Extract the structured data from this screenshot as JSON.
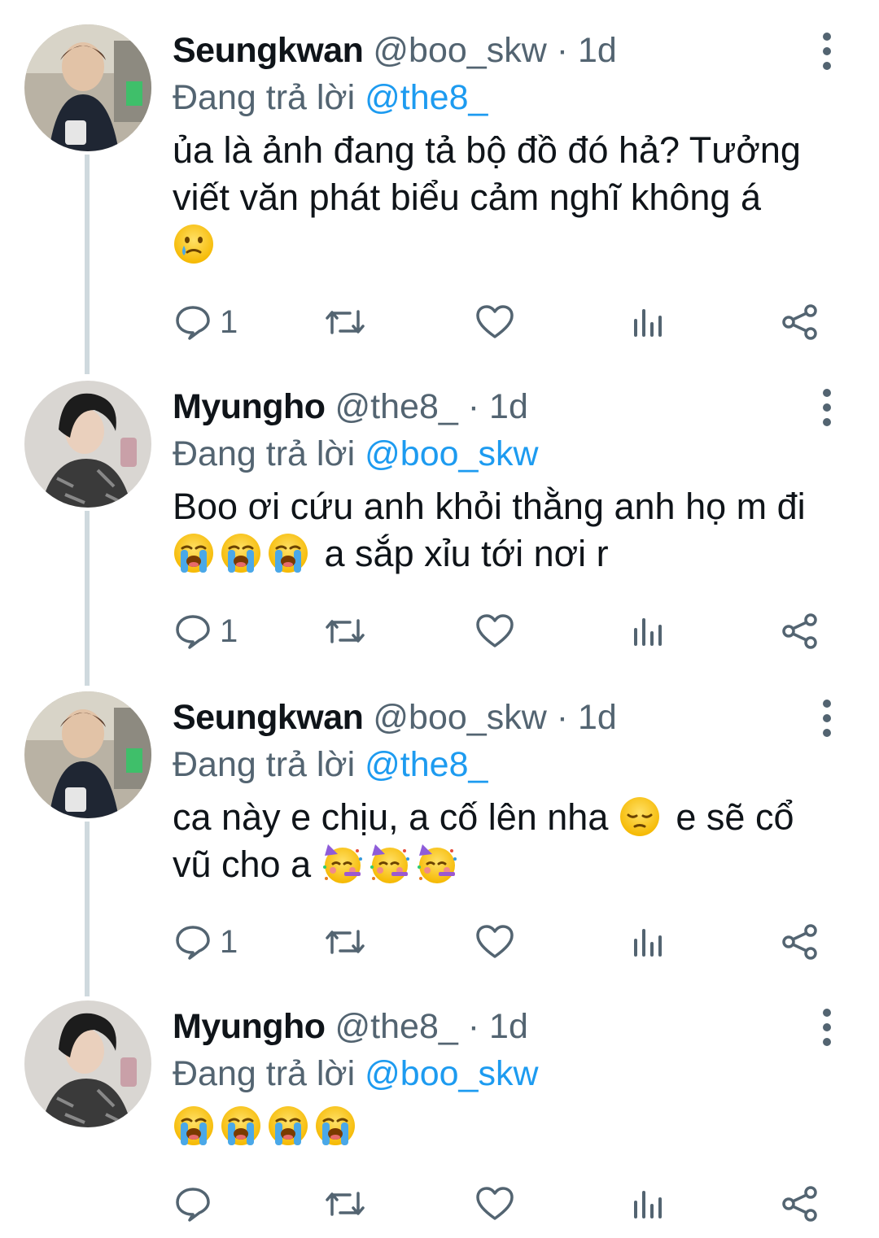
{
  "tweets": [
    {
      "name": "Seungkwan",
      "handle": "@boo_skw",
      "separator": "·",
      "time": "1d",
      "reply_prefix": "Đang trả lời",
      "reply_to": "@the8_",
      "text_line1": "ủa là ảnh đang tả bộ đồ đó hả? Tưởng",
      "text_line2": "viết văn phát biểu cảm nghĩ không á",
      "text_line3_emojis": [
        "holding-back-tears"
      ],
      "reply_count": "1"
    },
    {
      "name": "Myungho",
      "handle": "@the8_",
      "separator": "·",
      "time": "1d",
      "reply_prefix": "Đang trả lời",
      "reply_to": "@boo_skw",
      "text_line1": "Boo ơi cứu anh khỏi thằng anh họ m đi",
      "text_line2_emojis": [
        "loudly-crying",
        "loudly-crying",
        "loudly-crying"
      ],
      "text_line2_after": "a sắp xỉu tới nơi r",
      "reply_count": "1"
    },
    {
      "name": "Seungkwan",
      "handle": "@boo_skw",
      "separator": "·",
      "time": "1d",
      "reply_prefix": "Đang trả lời",
      "reply_to": "@the8_",
      "text_line1_before": "ca này e chịu, a cố lên nha",
      "text_line1_emoji": "pensive",
      "text_line1_after": "e sẽ cổ",
      "text_line2_before": "vũ cho a",
      "text_line2_emojis": [
        "partying",
        "partying",
        "partying"
      ],
      "reply_count": "1"
    },
    {
      "name": "Myungho",
      "handle": "@the8_",
      "separator": "·",
      "time": "1d",
      "reply_prefix": "Đang trả lời",
      "reply_to": "@boo_skw",
      "text_emojis": [
        "loudly-crying",
        "loudly-crying",
        "loudly-crying",
        "loudly-crying"
      ],
      "reply_count": ""
    }
  ],
  "icons": {
    "reply": "reply-icon",
    "retweet": "retweet-icon",
    "like": "heart-icon",
    "views": "views-icon",
    "share": "share-icon",
    "more": "more-vertical-icon"
  },
  "colors": {
    "text": "#0f1419",
    "secondary": "#536471",
    "mention": "#1d9bf0",
    "thread_line": "#cfd9de"
  }
}
